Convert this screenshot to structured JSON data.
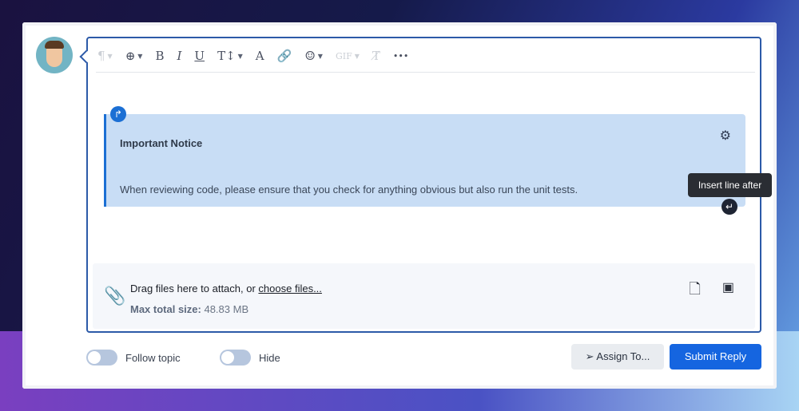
{
  "toolbar": {
    "items": [
      {
        "name": "paragraph",
        "glyph": "¶",
        "caret": true,
        "disabled": true
      },
      {
        "name": "insert",
        "glyph": "⊕",
        "caret": true
      },
      {
        "name": "bold",
        "glyph": "B"
      },
      {
        "name": "italic",
        "glyph": "I"
      },
      {
        "name": "underline",
        "glyph": "U"
      },
      {
        "name": "text-size",
        "glyph": "T↕",
        "caret": true
      },
      {
        "name": "text-color",
        "glyph": "A"
      },
      {
        "name": "link",
        "glyph": "🔗"
      },
      {
        "name": "emoji",
        "glyph": "☺",
        "caret": true
      },
      {
        "name": "gif",
        "glyph": "GIF",
        "caret": true,
        "disabled": true
      },
      {
        "name": "clear-format",
        "glyph": "T̸",
        "disabled": true
      },
      {
        "name": "more",
        "glyph": "•••"
      }
    ]
  },
  "notice": {
    "title": "Important Notice",
    "body": "When reviewing code, please ensure that you check for anything obvious but also run the unit tests."
  },
  "tooltip": "Insert line after",
  "attach": {
    "drag_text": "Drag files here to attach, or ",
    "choose_link": "choose files...",
    "max_label": "Max total size:",
    "max_value": " 48.83 MB"
  },
  "footer": {
    "follow_label": "Follow topic",
    "hide_label": "Hide",
    "assign_label": "Assign To...",
    "submit_label": "Submit Reply"
  },
  "colors": {
    "accent": "#1565e0",
    "notice_bg": "#c8ddf5"
  }
}
